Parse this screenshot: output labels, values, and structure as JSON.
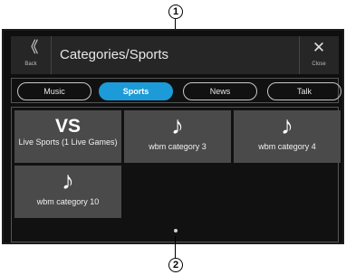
{
  "callouts": {
    "top": "1",
    "bottom": "2"
  },
  "header": {
    "back_icon": "double-chevron-left-icon",
    "back_glyph": "《",
    "back_label": "Back",
    "title": "Categories/Sports",
    "close_icon": "close-x-icon",
    "close_glyph": "✕",
    "close_label": "Close"
  },
  "tabs": [
    {
      "label": "Music",
      "active": false
    },
    {
      "label": "Sports",
      "active": true
    },
    {
      "label": "News",
      "active": false
    },
    {
      "label": "Talk",
      "active": false
    }
  ],
  "tiles": [
    {
      "icon": "vs-icon",
      "glyph": "VS",
      "label": "Live Sports (1 Live Games)"
    },
    {
      "icon": "music-note-icon",
      "glyph": "♪",
      "label": "wbm category 3"
    },
    {
      "icon": "music-note-icon",
      "glyph": "♪",
      "label": "wbm category 4"
    },
    {
      "icon": "music-note-icon",
      "glyph": "♪",
      "label": "wbm category 10"
    }
  ],
  "colors": {
    "accent": "#1d9bd8",
    "tile": "#4a4a4a",
    "background": "#0f0f10"
  },
  "pagination": {
    "current_page": 1
  }
}
